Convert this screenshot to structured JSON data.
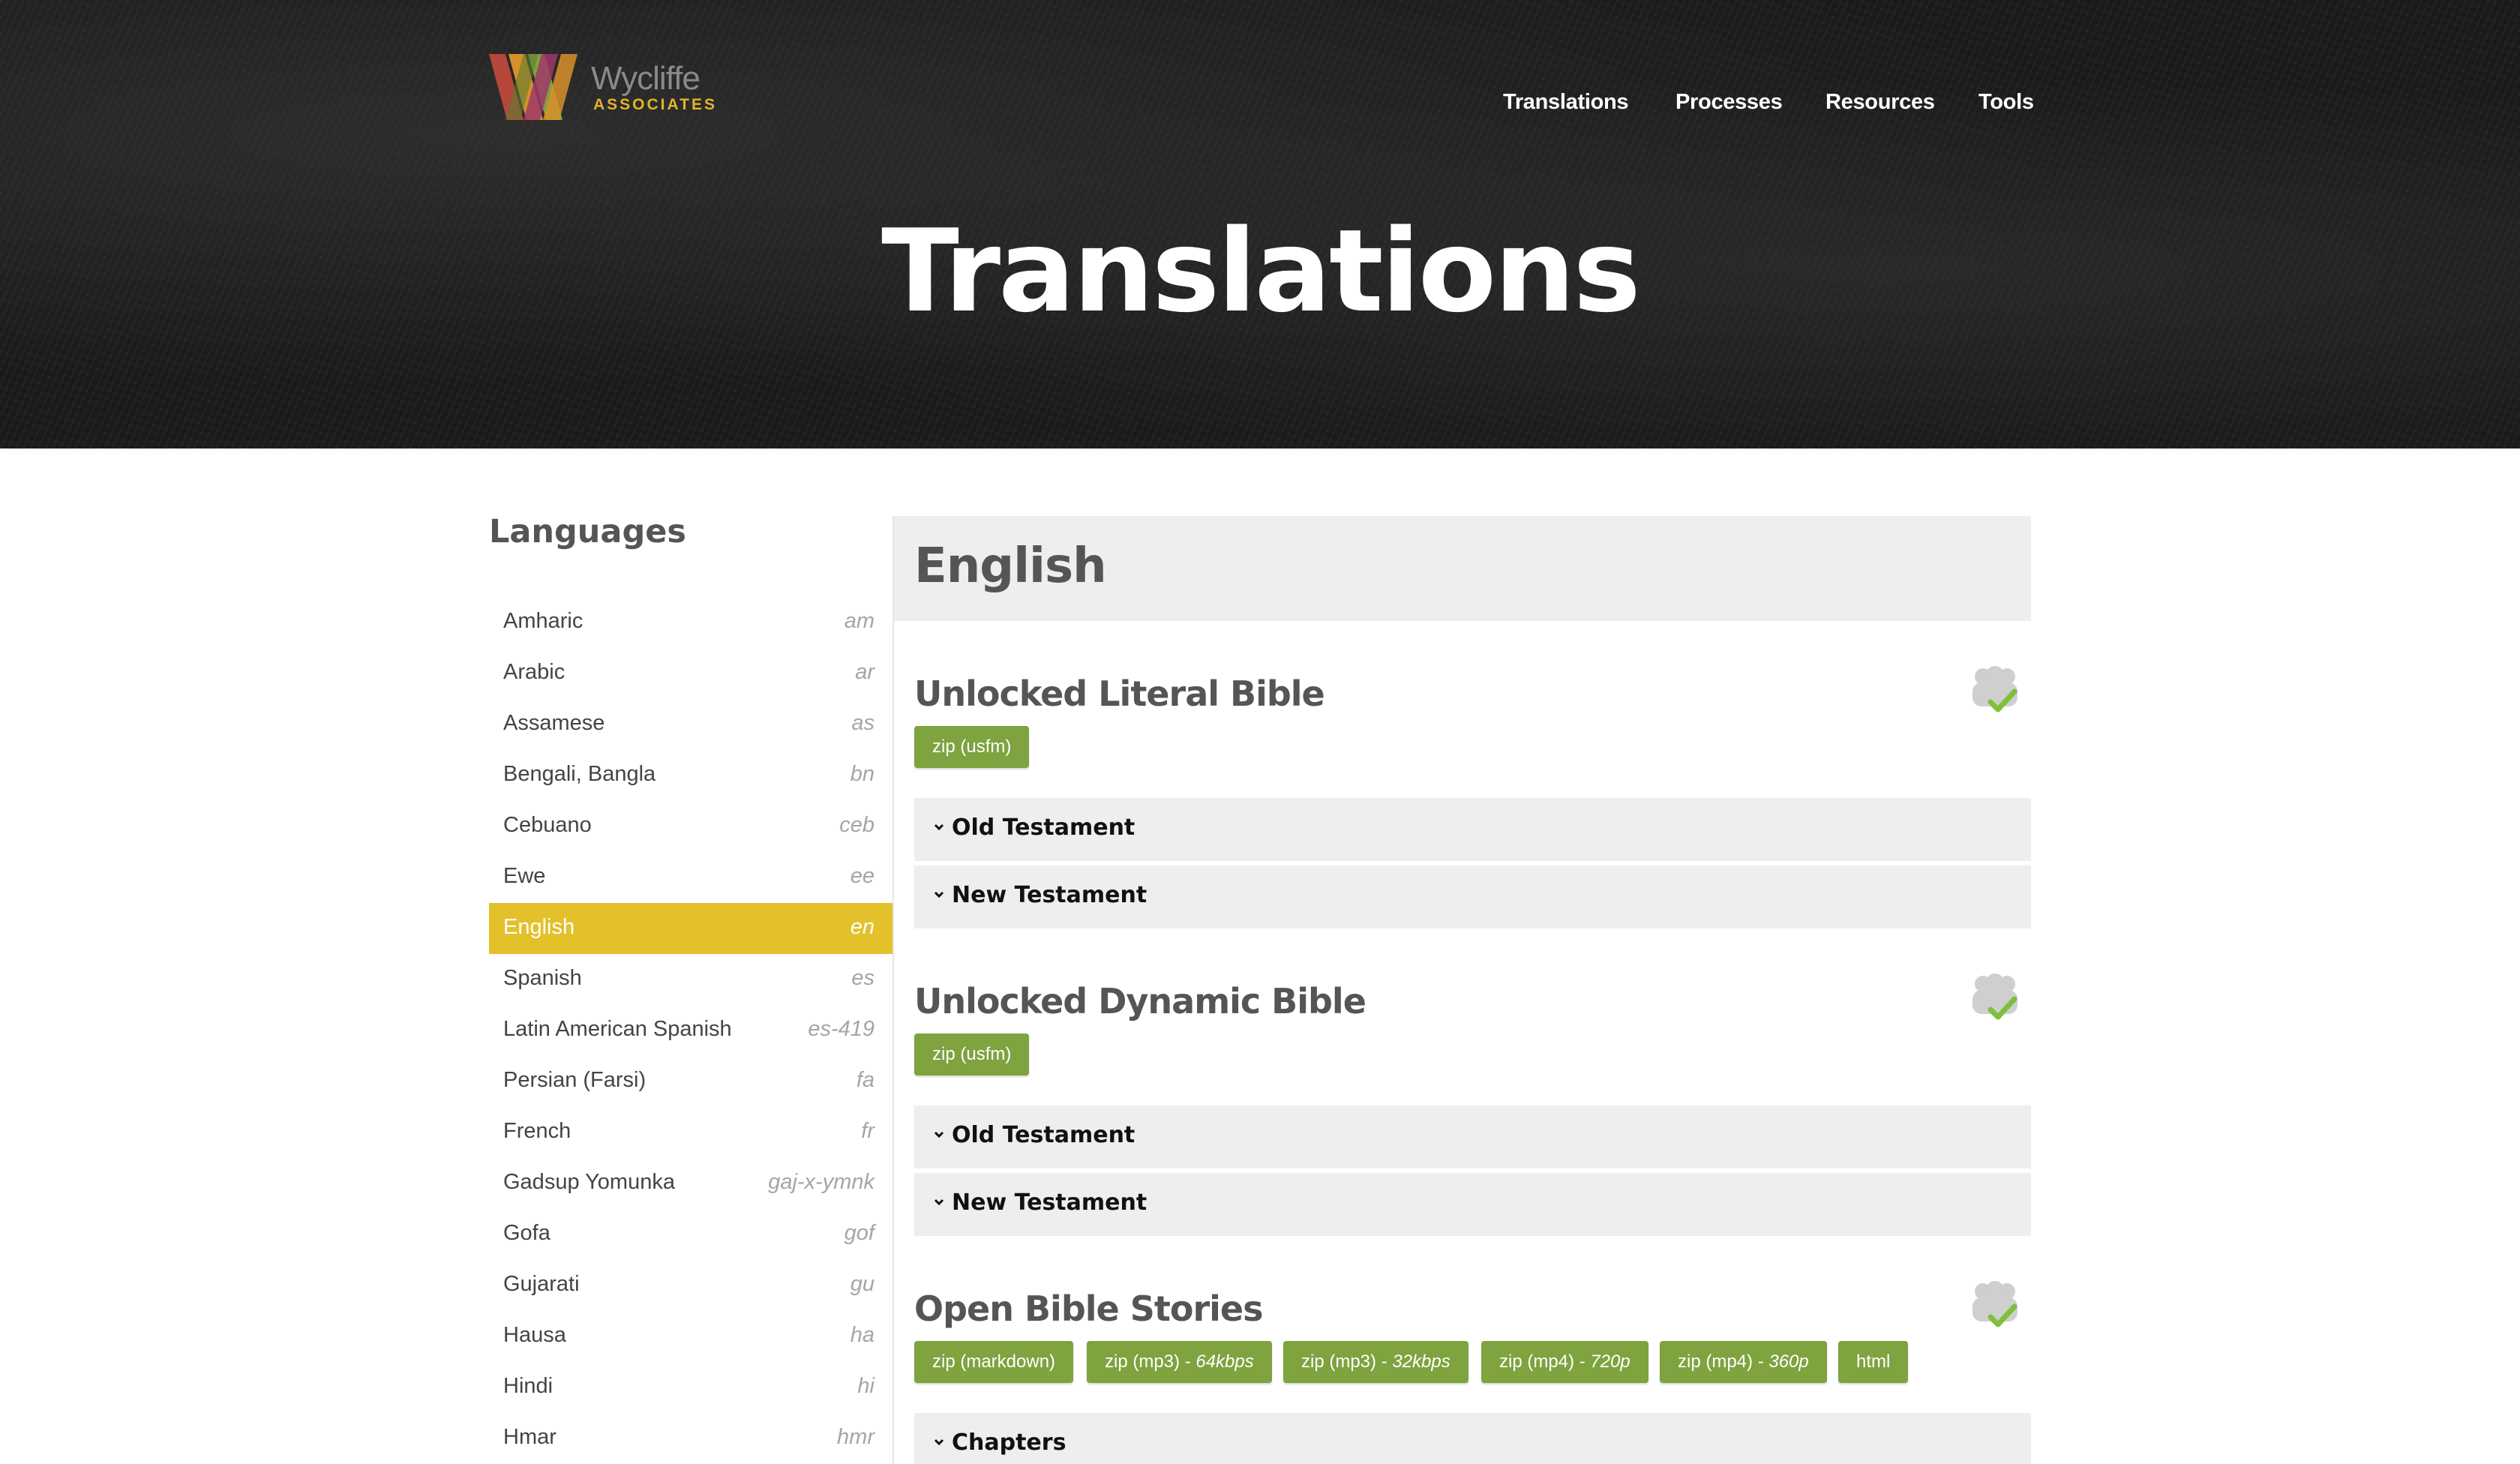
{
  "logo": {
    "word": "Wycliffe",
    "sub": "ASSOCIATES"
  },
  "nav": [
    {
      "label": "Translations"
    },
    {
      "label": "Processes"
    },
    {
      "label": "Resources"
    },
    {
      "label": "Tools"
    }
  ],
  "hero": {
    "title": "Translations"
  },
  "sidebar": {
    "title": "Languages",
    "languages": [
      {
        "name": "Amharic",
        "code": "am"
      },
      {
        "name": "Arabic",
        "code": "ar"
      },
      {
        "name": "Assamese",
        "code": "as"
      },
      {
        "name": "Bengali, Bangla",
        "code": "bn"
      },
      {
        "name": "Cebuano",
        "code": "ceb"
      },
      {
        "name": "Ewe",
        "code": "ee"
      },
      {
        "name": "English",
        "code": "en"
      },
      {
        "name": "Spanish",
        "code": "es"
      },
      {
        "name": "Latin American Spanish",
        "code": "es-419"
      },
      {
        "name": "Persian (Farsi)",
        "code": "fa"
      },
      {
        "name": "French",
        "code": "fr"
      },
      {
        "name": "Gadsup Yomunka",
        "code": "gaj-x-ymnk"
      },
      {
        "name": "Gofa",
        "code": "gof"
      },
      {
        "name": "Gujarati",
        "code": "gu"
      },
      {
        "name": "Hausa",
        "code": "ha"
      },
      {
        "name": "Hindi",
        "code": "hi"
      },
      {
        "name": "Hmar",
        "code": "hmr"
      }
    ],
    "selected": "English"
  },
  "main": {
    "language_title": "English",
    "sections": [
      {
        "title": "Unlocked Literal Bible",
        "icon": "verified-group-icon",
        "buttons": [
          {
            "label": "zip (usfm)"
          }
        ],
        "accordions": [
          {
            "label": "Old Testament"
          },
          {
            "label": "New Testament"
          }
        ]
      },
      {
        "title": "Unlocked Dynamic Bible",
        "icon": "verified-group-icon",
        "buttons": [
          {
            "label": "zip (usfm)"
          }
        ],
        "accordions": [
          {
            "label": "Old Testament"
          },
          {
            "label": "New Testament"
          }
        ]
      },
      {
        "title": "Open Bible Stories",
        "icon": "verified-group-icon",
        "buttons": [
          {
            "label": "zip (markdown)",
            "suffix": ""
          },
          {
            "label": "zip (mp3) - ",
            "suffix": "64kbps"
          },
          {
            "label": "zip (mp3) - ",
            "suffix": "32kbps"
          },
          {
            "label": "zip (mp4) - ",
            "suffix": "720p"
          },
          {
            "label": "zip (mp4) - ",
            "suffix": "360p"
          },
          {
            "label": "html",
            "suffix": ""
          }
        ],
        "accordions": [
          {
            "label": "Chapters"
          }
        ]
      }
    ]
  },
  "colors": {
    "accent_yellow": "#e2c12a",
    "button_green": "#7ea33f",
    "panel_gray": "#eeeeee",
    "logo_gold": "#e5b32a"
  }
}
